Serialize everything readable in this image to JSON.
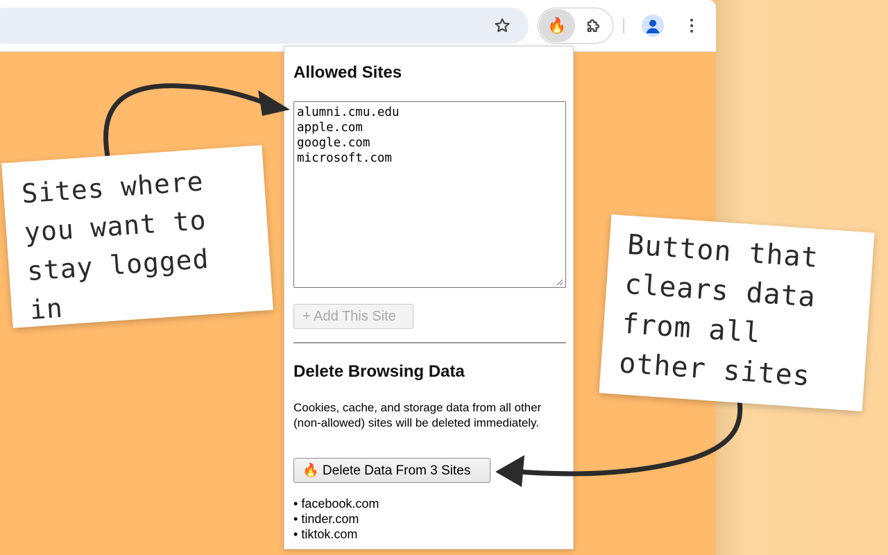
{
  "popup": {
    "allowed_title": "Allowed Sites",
    "allowed_sites_text": "alumni.cmu.edu\napple.com\ngoogle.com\nmicrosoft.com",
    "add_button_label": "+ Add This Site",
    "delete_title": "Delete Browsing Data",
    "description": "Cookies, cache, and storage data from all other (non-allowed) sites will be deleted immediately.",
    "delete_button_label": "🔥 Delete Data From 3 Sites",
    "sites_to_delete": [
      "facebook.com",
      "tinder.com",
      "tiktok.com"
    ]
  },
  "toolbar": {
    "extension_emoji": "🔥",
    "icons": [
      "star-icon",
      "fire-extension-icon",
      "puzzle-extension-icon",
      "profile-avatar-icon",
      "more-menu-icon"
    ]
  },
  "annotations": {
    "left_note": "Sites where you want to stay logged in",
    "right_note": "Button that clears data from all other sites"
  },
  "colors": {
    "page_background": "#ffba6b",
    "omnibox": "#e9eef6",
    "avatar": "#0b57d0"
  }
}
